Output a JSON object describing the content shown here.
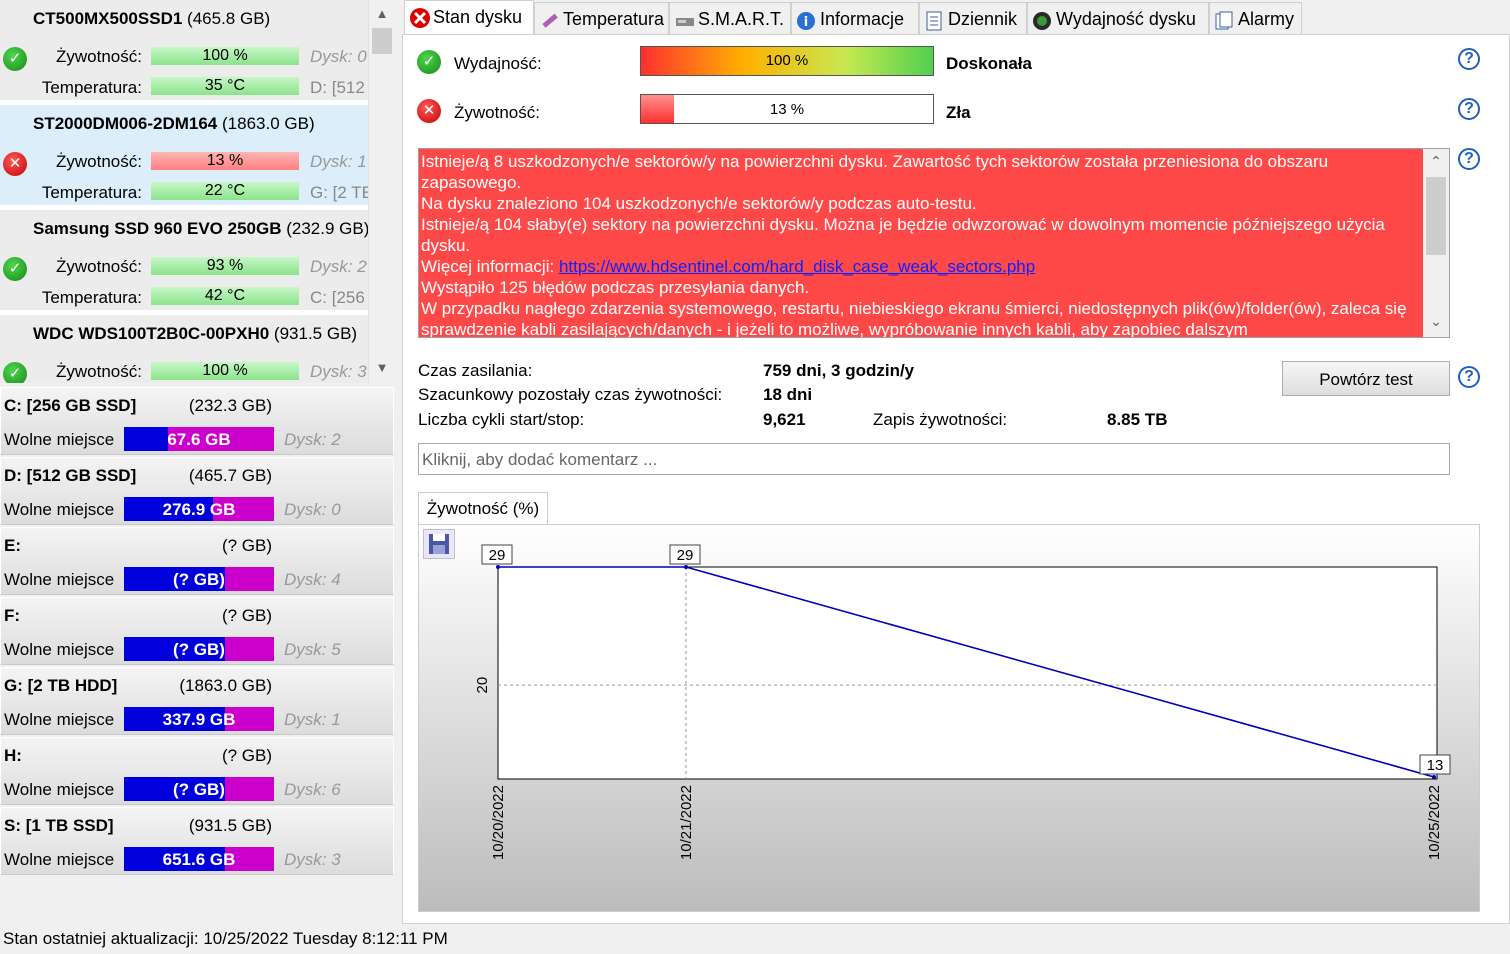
{
  "disks": [
    {
      "model": "CT500MX500SSD1",
      "size": "(465.8 GB)",
      "status": "ok",
      "health_label": "Żywotność:",
      "health": "100 %",
      "health_value": 100,
      "temp_label": "Temperatura:",
      "temp": "35 °C",
      "disk_idx": "Dysk: 0",
      "vol": "D: [512"
    },
    {
      "model": "ST2000DM006-2DM164",
      "size": "(1863.0 GB)",
      "status": "bad",
      "health_label": "Żywotność:",
      "health": "13 %",
      "health_value": 13,
      "temp_label": "Temperatura:",
      "temp": "22 °C",
      "disk_idx": "Dysk: 1",
      "vol": "G: [2 TE"
    },
    {
      "model": "Samsung SSD 960 EVO 250GB",
      "size": "(232.9 GB)",
      "status": "ok",
      "health_label": "Żywotność:",
      "health": "93 %",
      "health_value": 93,
      "temp_label": "Temperatura:",
      "temp": "42 °C",
      "disk_idx": "Dysk: 2",
      "vol": "C: [256"
    },
    {
      "model": "WDC WDS100T2B0C-00PXH0",
      "size": "(931.5 GB)",
      "status": "ok",
      "health_label": "Żywotność:",
      "health": "100 %",
      "health_value": 100,
      "temp_label": "",
      "temp": "",
      "disk_idx": "Dysk: 3",
      "vol": ""
    }
  ],
  "volumes": [
    {
      "name": "C: [256 GB SSD]",
      "size": "(232.3 GB)",
      "free_label": "Wolne miejsce",
      "free": "67.6 GB",
      "free_fraction": 0.29,
      "disk": "Dysk: 2"
    },
    {
      "name": "D: [512 GB SSD]",
      "size": "(465.7 GB)",
      "free_label": "Wolne miejsce",
      "free": "276.9 GB",
      "free_fraction": 0.59,
      "disk": "Dysk: 0"
    },
    {
      "name": "E:",
      "size": "(? GB)",
      "free_label": "Wolne miejsce",
      "free": "(? GB)",
      "free_fraction": 0.67,
      "disk": "Dysk: 4"
    },
    {
      "name": "F:",
      "size": "(? GB)",
      "free_label": "Wolne miejsce",
      "free": "(? GB)",
      "free_fraction": 0.67,
      "disk": "Dysk: 5"
    },
    {
      "name": "G: [2 TB HDD]",
      "size": "(1863.0 GB)",
      "free_label": "Wolne miejsce",
      "free": "337.9 GB",
      "free_fraction": 0.67,
      "disk": "Dysk: 1"
    },
    {
      "name": "H:",
      "size": "(? GB)",
      "free_label": "Wolne miejsce",
      "free": "(? GB)",
      "free_fraction": 0.67,
      "disk": "Dysk: 6"
    },
    {
      "name": "S: [1 TB SSD]",
      "size": "(931.5 GB)",
      "free_label": "Wolne miejsce",
      "free": "651.6 GB",
      "free_fraction": 0.67,
      "disk": "Dysk: 3"
    }
  ],
  "tabs": [
    "Stan dysku",
    "Temperatura",
    "S.M.A.R.T.",
    "Informacje",
    "Dziennik",
    "Wydajność dysku",
    "Alarmy"
  ],
  "performance": {
    "label": "Wydajność:",
    "value": "100 %",
    "percent": 100,
    "rating": "Doskonała"
  },
  "health": {
    "label": "Żywotność:",
    "value": "13 %",
    "percent": 13,
    "rating": "Zła"
  },
  "message": {
    "lines": [
      "Istnieje/ą 8 uszkodzonych/e sektorów/y na powierzchni dysku. Zawartość tych sektorów została przeniesiona do obszaru zapasowego.",
      "Na dysku znaleziono 104 uszkodzonych/e sektorów/y podczas auto-testu.",
      "Istnieje/ą 104 słaby(e) sektory na powierzchni dysku. Można je będzie odwzorować w dowolnym momencie późniejszego użycia dysku."
    ],
    "more_label": "Więcej informacji:",
    "link": "https://www.hdsentinel.com/hard_disk_case_weak_sectors.php",
    "lines2": [
      "Wystąpiło 125 błędów podczas przesyłania danych.",
      "W przypadku nagłego zdarzenia systemowego, restartu, niebieskiego ekranu śmierci, niedostępnych plik(ów)/folder(ów), zaleca się sprawdzenie kabli zasilających/danych - i jeżeli to możliwe, wypróbowanie innych kabli, aby zapobiec dalszym"
    ]
  },
  "stats": {
    "power_on_label": "Czas zasilania:",
    "power_on": "759 dni, 3 godzin/y",
    "remaining_label": "Szacunkowy pozostały czas żywotności:",
    "remaining": "18 dni",
    "cycles_label": "Liczba cykli start/stop:",
    "cycles": "9,621",
    "written_label": "Zapis żywotności:",
    "written": "8.85 TB"
  },
  "retest_label": "Powtórz test",
  "comment_placeholder": "Kliknij, aby dodać komentarz ...",
  "graph_tab": "Żywotność (%)",
  "chart_data": {
    "type": "line",
    "x": [
      "10/20/2022",
      "10/21/2022",
      "10/25/2022"
    ],
    "values": [
      29,
      29,
      13
    ],
    "ylim": [
      13,
      29
    ],
    "yticks": [
      20
    ],
    "grid": true
  },
  "status_bar": "Stan ostatniej aktualizacji: 10/25/2022 Tuesday 8:12:11 PM",
  "colors": {
    "ok": "#22aa22",
    "bad": "#dd0000",
    "message_bg": "#ff4848",
    "line": "#0000bb",
    "free": "#0000dd",
    "used": "#cc00cc"
  }
}
